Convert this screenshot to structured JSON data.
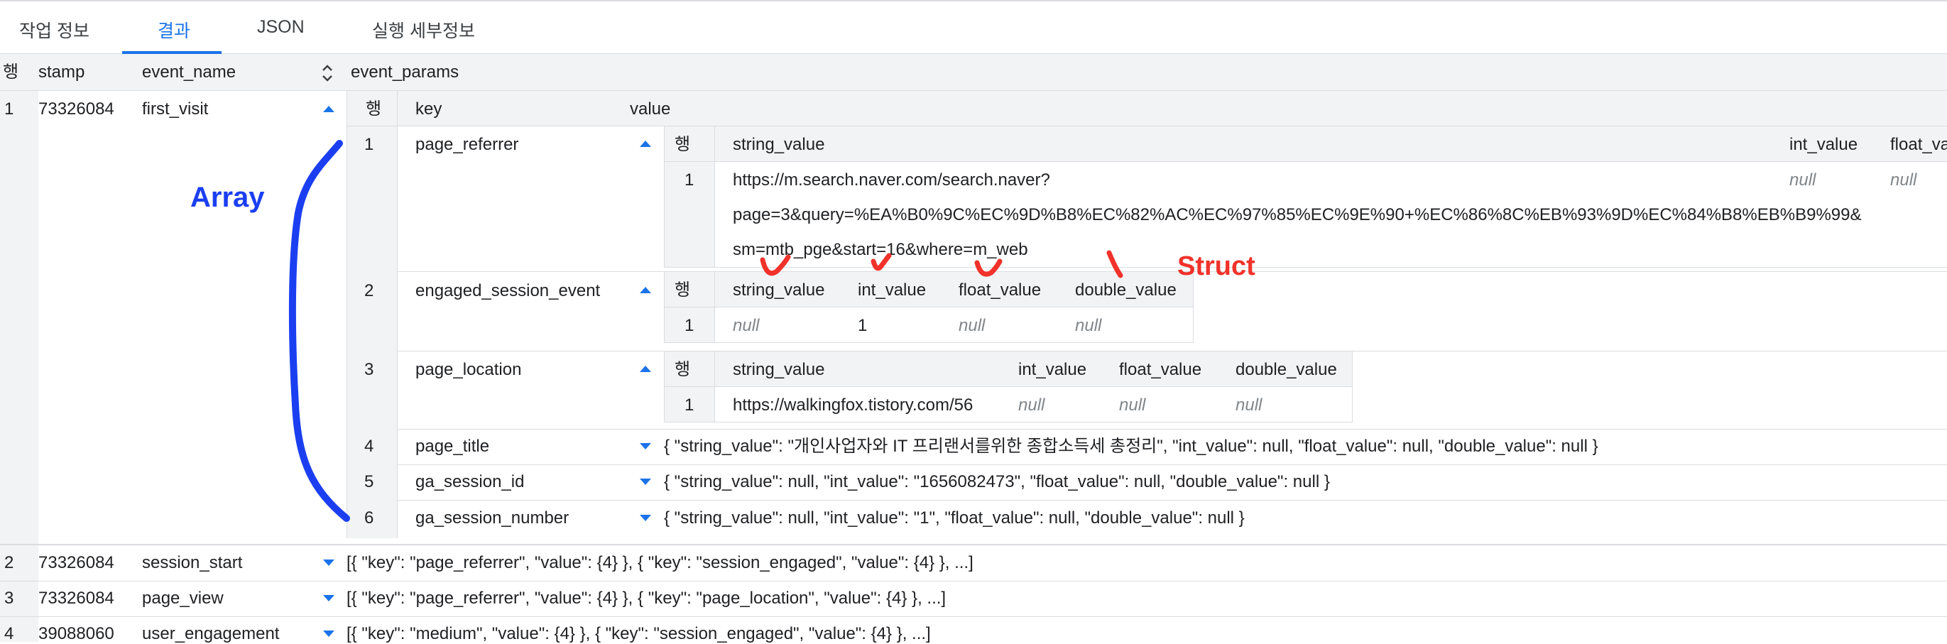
{
  "tabs": [
    {
      "label": "작업 정보",
      "active": false
    },
    {
      "label": "결과",
      "active": true
    },
    {
      "label": "JSON",
      "active": false
    },
    {
      "label": "실행 세부정보",
      "active": false
    }
  ],
  "columns": {
    "row": "행",
    "stamp": "stamp",
    "event_name": "event_name",
    "event_params": "event_params"
  },
  "inner_columns": {
    "row": "행",
    "key": "key",
    "value": "value"
  },
  "struct_columns": {
    "row": "행",
    "string_value": "string_value",
    "int_value": "int_value",
    "float_value": "float_value",
    "double_value": "double_value"
  },
  "rows": [
    {
      "num": "1",
      "stamp": "73326084",
      "event_name": "first_visit"
    },
    {
      "num": "2",
      "stamp": "73326084",
      "event_name": "session_start",
      "params_summary": "[{ \"key\": \"page_referrer\", \"value\": {4} }, { \"key\": \"session_engaged\", \"value\": {4} }, ...]"
    },
    {
      "num": "3",
      "stamp": "73326084",
      "event_name": "page_view",
      "params_summary": "[{ \"key\": \"page_referrer\", \"value\": {4} }, { \"key\": \"page_location\", \"value\": {4} }, ...]"
    },
    {
      "num": "4",
      "stamp": "39088060",
      "event_name": "user_engagement",
      "params_summary": "[{ \"key\": \"medium\", \"value\": {4} }, { \"key\": \"session_engaged\", \"value\": {4} }, ...]"
    }
  ],
  "params": [
    {
      "num": "1",
      "key": "page_referrer",
      "struct_row": "1",
      "url_lines": [
        "https://m.search.naver.com/search.naver?",
        "page=3&query=%EA%B0%9C%EC%9D%B8%EC%82%AC%EC%97%85%EC%9E%90+%EC%86%8C%EB%93%9D%EC%84%B8%EB%B9%99&",
        "sm=mtb_pge&start=16&where=m_web"
      ],
      "int_value": "null",
      "float_value": "null",
      "float_header": "float_va"
    },
    {
      "num": "2",
      "key": "engaged_session_event",
      "struct_row": "1",
      "string_value": "null",
      "int_value": "1",
      "float_value": "null",
      "double_value": "null"
    },
    {
      "num": "3",
      "key": "page_location",
      "struct_row": "1",
      "string_value": "https://walkingfox.tistory.com/56",
      "int_value": "null",
      "float_value": "null",
      "double_value": "null"
    },
    {
      "num": "4",
      "key": "page_title",
      "summary": "{ \"string_value\": \"개인사업자와 IT 프리랜서를위한 종합소득세 총정리\", \"int_value\": null, \"float_value\": null, \"double_value\": null }"
    },
    {
      "num": "5",
      "key": "ga_session_id",
      "summary": "{ \"string_value\": null, \"int_value\": \"1656082473\", \"float_value\": null, \"double_value\": null }"
    },
    {
      "num": "6",
      "key": "ga_session_number",
      "summary": "{ \"string_value\": null, \"int_value\": \"1\", \"float_value\": null, \"double_value\": null }"
    }
  ],
  "annotations": {
    "array": "Array",
    "struct": "Struct"
  },
  "colors": {
    "accent": "#1a73e8",
    "annotation_blue": "#1b3ff0",
    "annotation_red": "#f0322a",
    "header_bg": "#f1f3f4",
    "border": "#dadce0"
  },
  "icons": {
    "sort": "sort-icon",
    "expand": "expand-icon",
    "collapse": "collapse-icon"
  }
}
